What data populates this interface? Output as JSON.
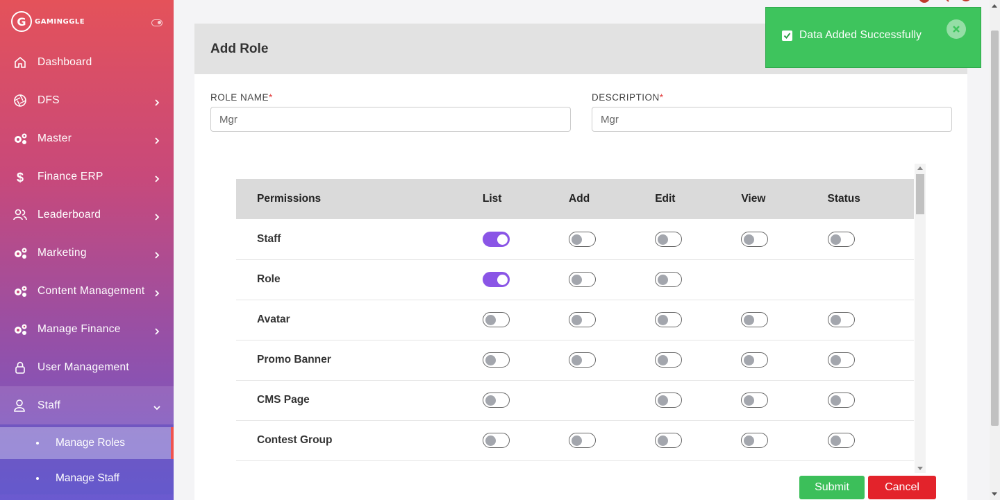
{
  "brand": {
    "logo_letter": "G",
    "name": "GAMINGGLE"
  },
  "sidebar": {
    "items": [
      {
        "label": "Dashboard",
        "icon": "home-icon"
      },
      {
        "label": "DFS",
        "icon": "aperture-icon"
      },
      {
        "label": "Master",
        "icon": "gears-icon"
      },
      {
        "label": "Finance ERP",
        "icon": "dollar-icon"
      },
      {
        "label": "Leaderboard",
        "icon": "users-icon"
      },
      {
        "label": "Marketing",
        "icon": "gears-icon"
      },
      {
        "label": "Content Management",
        "icon": "gears-icon"
      },
      {
        "label": "Manage Finance",
        "icon": "gears-icon"
      },
      {
        "label": "User Management",
        "icon": "lock-icon"
      },
      {
        "label": "Staff",
        "icon": "user-icon"
      }
    ],
    "sub_items": [
      {
        "label": "Manage Roles"
      },
      {
        "label": "Manage Staff"
      }
    ]
  },
  "card": {
    "title": "Add Role",
    "role_name_label": "ROLE NAME",
    "description_label": "DESCRIPTION",
    "required_mark": "*",
    "role_name_value": "Mgr",
    "description_value": "Mgr"
  },
  "permissions": {
    "headers": [
      "Permissions",
      "List",
      "Add",
      "Edit",
      "View",
      "Status"
    ],
    "rows": [
      {
        "name": "Staff",
        "toggles": [
          true,
          false,
          false,
          false,
          false
        ]
      },
      {
        "name": "Role",
        "toggles": [
          true,
          false,
          false,
          null,
          null
        ]
      },
      {
        "name": "Avatar",
        "toggles": [
          false,
          false,
          false,
          false,
          false
        ]
      },
      {
        "name": "Promo Banner",
        "toggles": [
          false,
          false,
          false,
          false,
          false
        ]
      },
      {
        "name": "CMS Page",
        "toggles": [
          false,
          null,
          false,
          false,
          false
        ]
      },
      {
        "name": "Contest Group",
        "toggles": [
          false,
          false,
          false,
          false,
          false
        ]
      },
      {
        "name": "",
        "toggles": [
          false,
          false,
          false,
          false,
          false
        ]
      }
    ]
  },
  "buttons": {
    "submit": "Submit",
    "cancel": "Cancel"
  },
  "toast": {
    "message": "Data Added Successfully",
    "color": "#3ec45d"
  },
  "colors": {
    "accent_toggle": "#8a55e6",
    "submit": "#3cbf5a",
    "cancel": "#e3232b"
  }
}
